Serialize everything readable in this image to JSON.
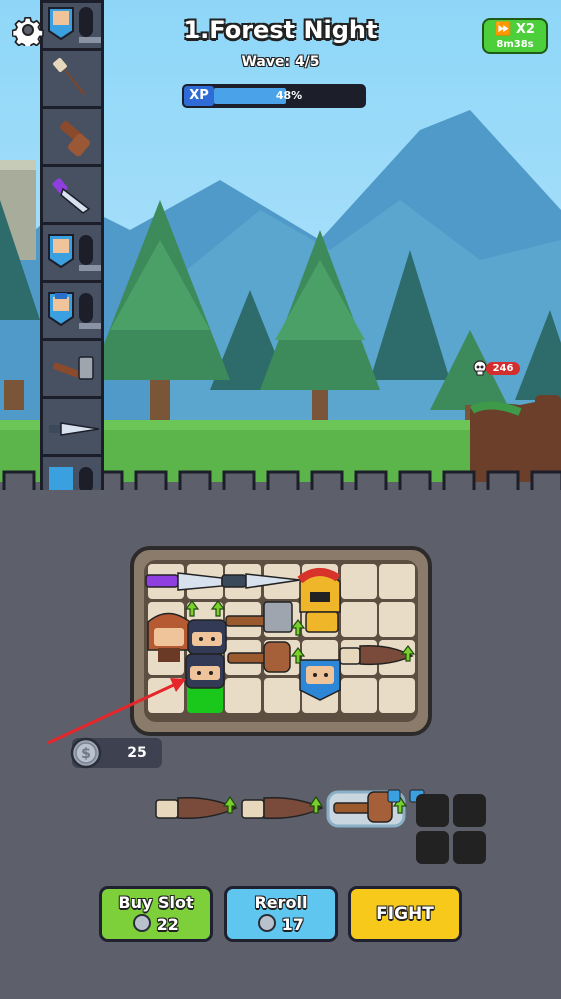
{
  "header": {
    "level_title": "1.Forest Night",
    "wave_text": "Wave: 4/5",
    "xp_label": "XP",
    "xp_percent_text": "48%",
    "xp_progress": 0.48
  },
  "speed_button": {
    "label": "X2",
    "timer": "8m38s"
  },
  "enemy": {
    "hp": "246"
  },
  "coins": {
    "amount": "25"
  },
  "buttons": {
    "buy_slot_label": "Buy Slot",
    "buy_slot_cost": "22",
    "reroll_label": "Reroll",
    "reroll_cost": "17",
    "fight_label": "FIGHT"
  },
  "colors": {
    "buy_slot": "#7ed03b",
    "reroll": "#5fc6ef",
    "fight": "#f6c91a",
    "empty_highlight": "#19c81a",
    "xp_fill": "#4aa3e8",
    "hp_badge": "#d32d2d"
  },
  "icons": [
    "gear-icon",
    "fast-forward-icon",
    "skull-icon",
    "coin-icon",
    "arrow-pointer"
  ]
}
